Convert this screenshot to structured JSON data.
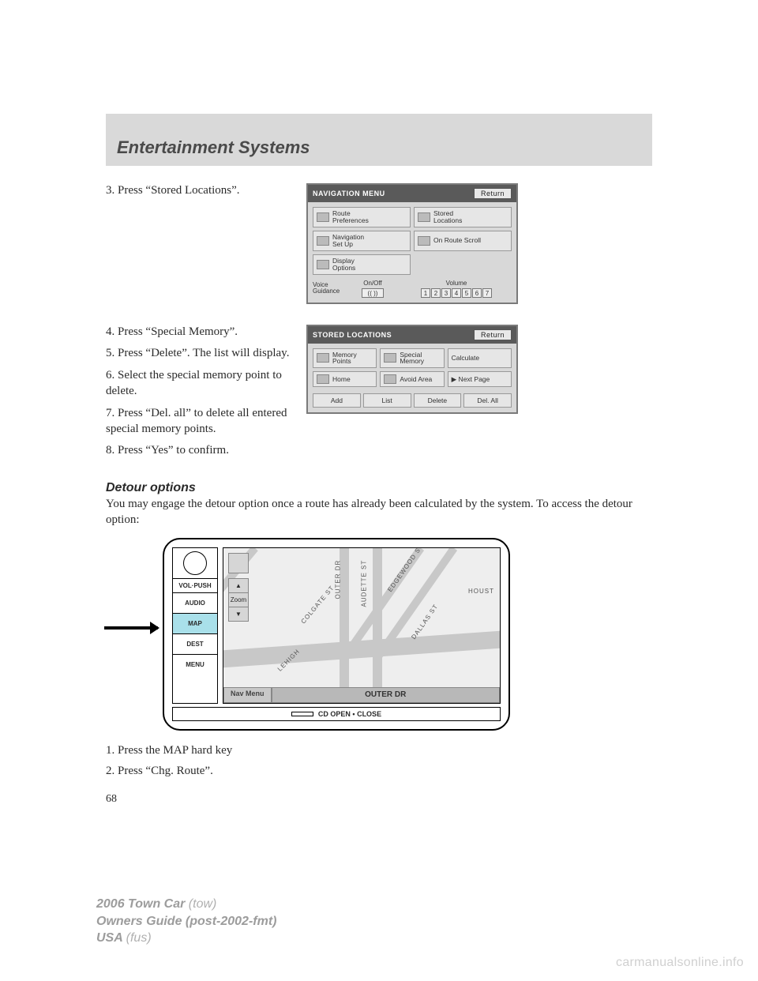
{
  "header": {
    "title": "Entertainment Systems"
  },
  "step3": "3. Press “Stored Locations”.",
  "nav_menu": {
    "title": "NAVIGATION MENU",
    "return": "Return",
    "cells": [
      "Route\nPreferences",
      "Stored\nLocations",
      "Navigation\nSet Up",
      "On Route Scroll",
      "Display\nOptions",
      ""
    ],
    "voice_label": "Voice\nGuidance",
    "onoff": "On/Off",
    "volume": "Volume",
    "vol_nums": [
      "1",
      "2",
      "3",
      "4",
      "5",
      "6",
      "7"
    ]
  },
  "steps_left": [
    "4. Press “Special Memory”.",
    "5. Press “Delete”. The list will display.",
    "6. Select the special memory point to delete.",
    "7. Press “Del. all” to delete all entered special memory points.",
    "8. Press “Yes” to confirm."
  ],
  "stored_loc": {
    "title": "STORED LOCATIONS",
    "return": "Return",
    "cells": [
      "Memory\nPoints",
      "Special\nMemory",
      "Calculate",
      "Home",
      "Avoid Area",
      "▶ Next Page"
    ],
    "bottom": [
      "Add",
      "List",
      "Delete",
      "Del. All"
    ]
  },
  "detour": {
    "heading": "Detour options",
    "intro": "You may engage the detour option once a route has already been calculated by the system. To access the detour option:"
  },
  "hardkeys": {
    "vol": "VOL·PUSH",
    "audio": "AUDIO",
    "map": "MAP",
    "dest": "DEST",
    "menu": "MENU",
    "cd": "CD OPEN • CLOSE"
  },
  "map": {
    "zoom": "Zoom",
    "navmenu": "Nav Menu",
    "road": "OUTER DR",
    "streets": [
      "LEHIGH",
      "COLGATE ST",
      "OUTER DR",
      "AUDETTE ST",
      "EDGEWOOD ST",
      "DALLAS ST",
      "HOUST"
    ]
  },
  "after_steps": [
    "1. Press the MAP hard key",
    "2. Press “Chg. Route”."
  ],
  "page_number": "68",
  "footer": {
    "line1a": "2006 Town Car",
    "line1b": "(tow)",
    "line2a": "Owners Guide (post-2002-fmt)",
    "line3a": "USA",
    "line3b": "(fus)"
  },
  "watermark": "carmanualsonline.info"
}
